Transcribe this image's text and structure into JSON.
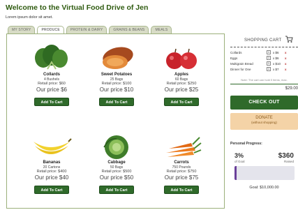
{
  "header": {
    "title": "Welcome to the Virtual Food Drive of Jen",
    "intro": "Lorem ipsum dolor sit amet."
  },
  "tabs": [
    {
      "label": "MY STORY",
      "active": false
    },
    {
      "label": "PRODUCE",
      "active": true
    },
    {
      "label": "PROTEIN & DAIRY",
      "active": false
    },
    {
      "label": "GRAINS & BEANS",
      "active": false
    },
    {
      "label": "MEALS",
      "active": false
    }
  ],
  "products": [
    {
      "name": "Collards",
      "qty": "4 Bushels",
      "retail": "Retail price: $60",
      "ours": "Our price $6",
      "button": "Add To Cart",
      "icon": "collards-icon"
    },
    {
      "name": "Sweet Potatoes",
      "qty": "25 Bags",
      "retail": "Retail price: $100",
      "ours": "Our price $10",
      "button": "Add To Cart",
      "icon": "sweet-potato-icon"
    },
    {
      "name": "Apples",
      "qty": "60 Bags",
      "retail": "Retail price: $250",
      "ours": "Our price $25",
      "button": "Add To Cart",
      "icon": "apples-icon"
    },
    {
      "name": "Bananas",
      "qty": "20 Cartons",
      "retail": "Retail price: $400",
      "ours": "Our price $40",
      "button": "Add To Cart",
      "icon": "bananas-icon"
    },
    {
      "name": "Cabbage",
      "qty": "50 Bags",
      "retail": "Retail price: $500",
      "ours": "Our price $50",
      "button": "Add To Cart",
      "icon": "cabbage-icon"
    },
    {
      "name": "Carrots",
      "qty": "750 Pounds",
      "retail": "Retail price: $750",
      "ours": "Our price $75",
      "button": "Add To Cart",
      "icon": "carrots-icon"
    }
  ],
  "cart": {
    "title": "SHOPPING CART",
    "items": [
      {
        "name": "Collards",
        "qty": "1",
        "price": "x $6",
        "remove": "x"
      },
      {
        "name": "Eggs",
        "qty": "1",
        "price": "x $6",
        "remove": "x"
      },
      {
        "name": "Multigrain Bread",
        "qty": "1",
        "price": "x $10",
        "remove": "x"
      },
      {
        "name": "Dinner for One",
        "qty": "1",
        "price": "x $7",
        "remove": "x"
      }
    ],
    "note": "Note: The cart can hold 0 items, max.",
    "total": "$29.00"
  },
  "actions": {
    "checkout": "CHECK OUT",
    "donate": "DONATE",
    "donate_sub": "(without shopping)"
  },
  "progress": {
    "title": "Personal Progress:",
    "percent": "3%",
    "percent_label": "of Goal",
    "raised": "$360",
    "raised_label": "Raised",
    "fill_fraction": 0.03,
    "goal": "Goal: $10,000.00"
  },
  "colors": {
    "accent_green": "#2f6a2a",
    "donate_bg": "#f4d3a7",
    "progress_fill": "#6a3f99"
  }
}
